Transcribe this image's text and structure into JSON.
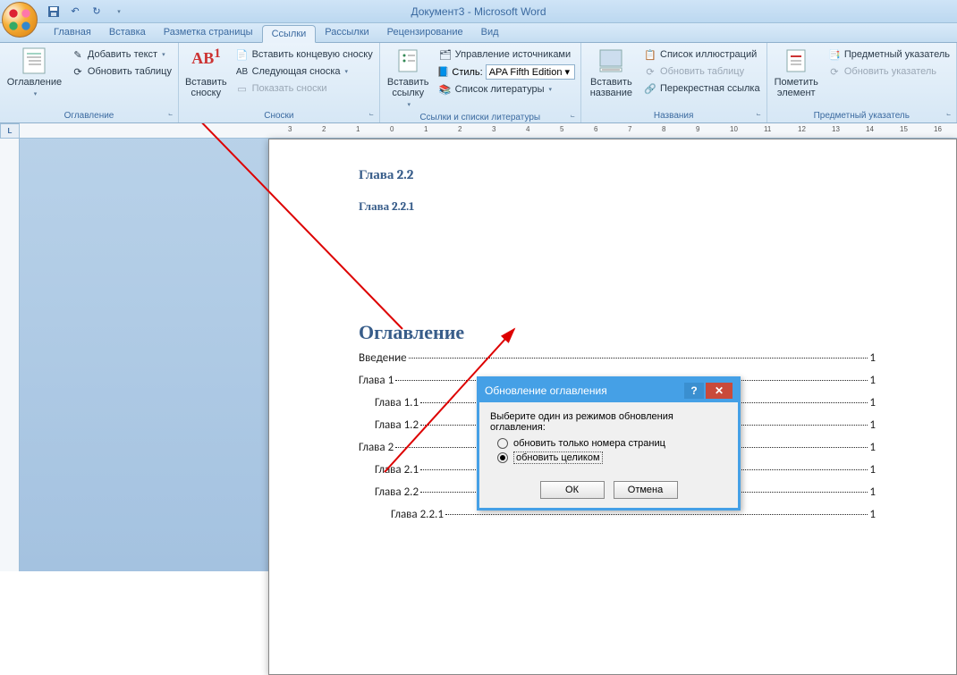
{
  "title": "Документ3 - Microsoft Word",
  "tabs": [
    "Главная",
    "Вставка",
    "Разметка страницы",
    "Ссылки",
    "Рассылки",
    "Рецензирование",
    "Вид"
  ],
  "active_tab": 3,
  "ribbon": {
    "toc": {
      "label": "Оглавление",
      "big": "Оглавление",
      "add_text": "Добавить текст",
      "update": "Обновить таблицу"
    },
    "footnotes": {
      "label": "Сноски",
      "big": "Вставить сноску",
      "end": "Вставить концевую сноску",
      "next": "Следующая сноска",
      "show": "Показать сноски"
    },
    "citations": {
      "label": "Ссылки и списки литературы",
      "big": "Вставить ссылку",
      "manage": "Управление источниками",
      "style_lbl": "Стиль:",
      "style_val": "APA Fifth Edition",
      "bib": "Список литературы"
    },
    "captions": {
      "label": "Названия",
      "big": "Вставить название",
      "fig": "Список иллюстраций",
      "update": "Обновить таблицу",
      "xref": "Перекрестная ссылка"
    },
    "index": {
      "label": "Предметный указатель",
      "big": "Пометить элемент",
      "idx": "Предметный указатель",
      "update": "Обновить указатель"
    }
  },
  "doc": {
    "h22": "Глава 2.2",
    "h221": "Глава 2.2.1",
    "toc_title": "Оглавление",
    "items": [
      {
        "label": "Введение",
        "pn": "1",
        "ind": 0
      },
      {
        "label": "Глава 1",
        "pn": "1",
        "ind": 0
      },
      {
        "label": "Глава 1.1",
        "pn": "1",
        "ind": 1
      },
      {
        "label": "Глава 1.2",
        "pn": "1",
        "ind": 1
      },
      {
        "label": "Глава 2",
        "pn": "1",
        "ind": 0
      },
      {
        "label": "Глава 2.1",
        "pn": "1",
        "ind": 1
      },
      {
        "label": "Глава 2.2",
        "pn": "1",
        "ind": 1
      },
      {
        "label": "Глава 2.2.1",
        "pn": "1",
        "ind": 2
      }
    ]
  },
  "dialog": {
    "title": "Обновление оглавления",
    "prompt": "Выберите один из режимов обновления оглавления:",
    "opt1": "обновить только номера страниц",
    "opt2": "обновить целиком",
    "selected": 2,
    "ok": "ОК",
    "cancel": "Отмена"
  },
  "ruler_corner": "L"
}
